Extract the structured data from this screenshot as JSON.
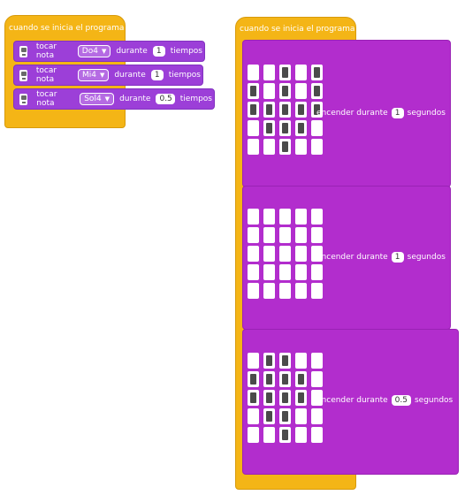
{
  "program1": {
    "hat_label": "cuando se inicia el programa",
    "blocks": [
      {
        "action": "tocar nota",
        "note": "Do4",
        "during": "durante",
        "value": "1",
        "unit": "tiempos"
      },
      {
        "action": "tocar nota",
        "note": "Mi4",
        "during": "durante",
        "value": "1",
        "unit": "tiempos"
      },
      {
        "action": "tocar nota",
        "note": "Sol4",
        "during": "durante",
        "value": "0.5",
        "unit": "tiempos"
      }
    ]
  },
  "program2": {
    "hat_label": "cuando se inicia el programa",
    "blocks": [
      {
        "label": "encender durante",
        "value": "1",
        "unit": "segundos",
        "matrix": [
          [
            0,
            0,
            1,
            0,
            1
          ],
          [
            1,
            0,
            1,
            0,
            1
          ],
          [
            1,
            1,
            1,
            1,
            1
          ],
          [
            0,
            1,
            1,
            1,
            0
          ],
          [
            0,
            0,
            1,
            0,
            0
          ]
        ]
      },
      {
        "label": "encender durante",
        "value": "1",
        "unit": "segundos",
        "matrix": [
          [
            0,
            0,
            0,
            0,
            0
          ],
          [
            0,
            0,
            0,
            0,
            0
          ],
          [
            0,
            0,
            0,
            0,
            0
          ],
          [
            0,
            0,
            0,
            0,
            0
          ],
          [
            0,
            0,
            0,
            0,
            0
          ]
        ]
      },
      {
        "label": "encender durante",
        "value": "0.5",
        "unit": "segundos",
        "matrix": [
          [
            0,
            1,
            1,
            0,
            0
          ],
          [
            1,
            1,
            1,
            1,
            0
          ],
          [
            1,
            1,
            1,
            1,
            0
          ],
          [
            0,
            1,
            1,
            0,
            0
          ],
          [
            0,
            0,
            1,
            0,
            0
          ]
        ]
      }
    ]
  },
  "colors": {
    "event_yellow": "#f4b516",
    "sound_purple": "#9c3fd8",
    "display_magenta": "#b22dcd",
    "led_off": "#ffffff",
    "led_on": "#4b4b4b"
  },
  "icons": {
    "sound_block": "speaker-icon",
    "dropdown": "caret-down-icon"
  }
}
